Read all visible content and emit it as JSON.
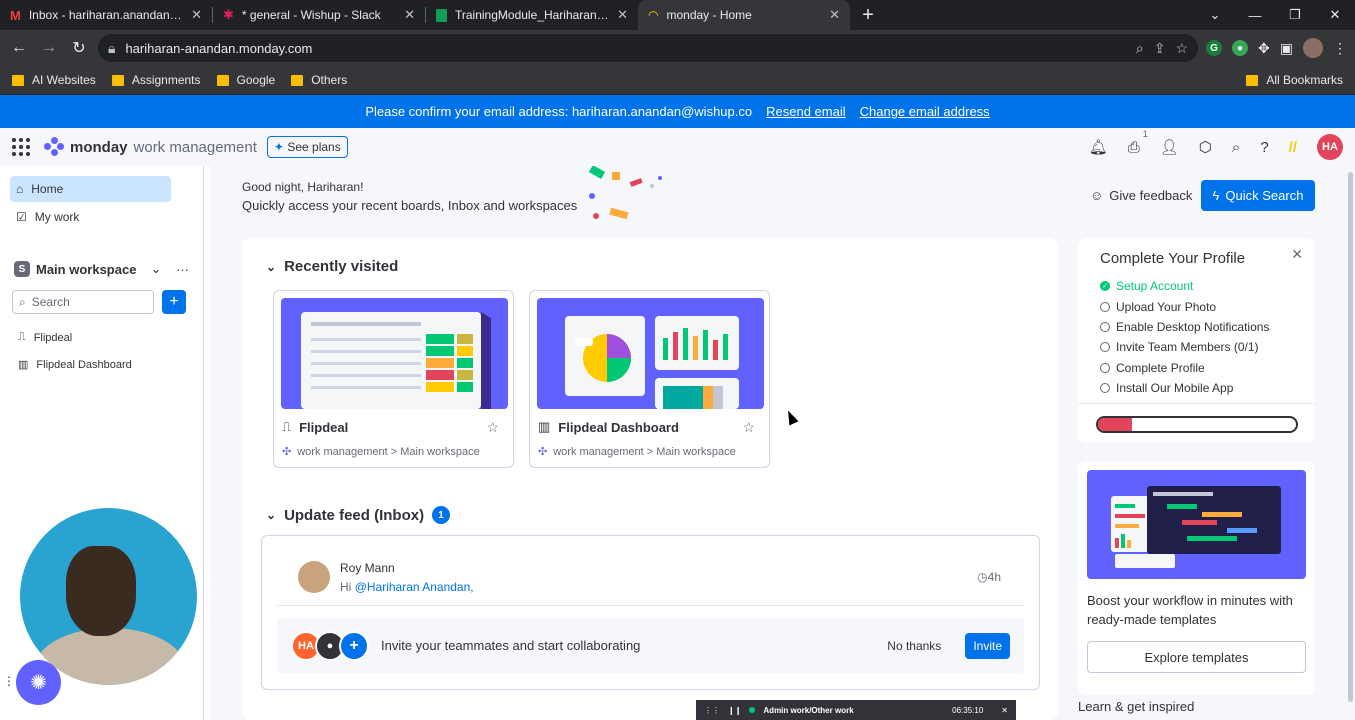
{
  "browser": {
    "tabs": [
      {
        "title": "Inbox - hariharan.anandan@wishup.co",
        "icon": "gmail-icon"
      },
      {
        "title": "* general - Wishup - Slack",
        "icon": "slack-icon"
      },
      {
        "title": "TrainingModule_HariharanAnandan",
        "icon": "sheets-icon"
      },
      {
        "title": "monday - Home",
        "icon": "monday-icon"
      }
    ],
    "url": "hariharan-anandan.monday.com",
    "bookmarks": [
      "AI Websites",
      "Assignments",
      "Google",
      "Others"
    ],
    "all_bookmarks": "All Bookmarks"
  },
  "banner": {
    "text": "Please confirm your email address: hariharan.anandan@wishup.co",
    "resend": "Resend email",
    "change": "Change email address"
  },
  "topnav": {
    "brand_bold": "monday",
    "brand_rest": "work management",
    "see_plans": "See plans",
    "inbox_count": "1",
    "avatar": "HA"
  },
  "sidebar": {
    "items": [
      {
        "label": "Home",
        "icon": "home-icon"
      },
      {
        "label": "My work",
        "icon": "calendar-icon"
      }
    ],
    "workspace": "Main workspace",
    "workspace_initial": "S",
    "search_placeholder": "Search",
    "boards": [
      {
        "label": "Flipdeal",
        "icon": "board-icon"
      },
      {
        "label": "Flipdeal Dashboard",
        "icon": "dashboard-icon"
      }
    ]
  },
  "header": {
    "greeting": "Good night, Hariharan!",
    "subtitle": "Quickly access your recent boards, Inbox and workspaces",
    "feedback": "Give feedback",
    "quick_search": "Quick Search"
  },
  "recent": {
    "title": "Recently visited",
    "boards": [
      {
        "name": "Flipdeal",
        "crumb": "work management > Main workspace"
      },
      {
        "name": "Flipdeal Dashboard",
        "crumb": "work management > Main workspace"
      }
    ]
  },
  "feed": {
    "title": "Update feed (Inbox)",
    "count": "1",
    "author": "Roy Mann",
    "greeting_word": "Hi",
    "mention": "@Hariharan Anandan,",
    "time": "4h",
    "invite_text": "Invite your teammates and start collaborating",
    "no_thanks": "No thanks",
    "invite": "Invite",
    "invite_avatar": "HA"
  },
  "profile": {
    "title": "Complete Your Profile",
    "steps": [
      {
        "label": "Setup Account",
        "done": true
      },
      {
        "label": "Upload Your Photo",
        "done": false
      },
      {
        "label": "Enable Desktop Notifications",
        "done": false
      },
      {
        "label": "Invite Team Members (0/1)",
        "done": false
      },
      {
        "label": "Complete Profile",
        "done": false
      },
      {
        "label": "Install Our Mobile App",
        "done": false
      }
    ],
    "progress": 0.17
  },
  "templates": {
    "text": "Boost your workflow in minutes with ready-made templates",
    "button": "Explore templates",
    "learn": "Learn & get inspired"
  },
  "recorder": {
    "label": "Admin work/Other work",
    "time": "06:35:10"
  },
  "colors": {
    "accent": "#0073ea",
    "purple": "#6161ff",
    "done_green": "#00c875",
    "progress_red": "#e2445c"
  }
}
